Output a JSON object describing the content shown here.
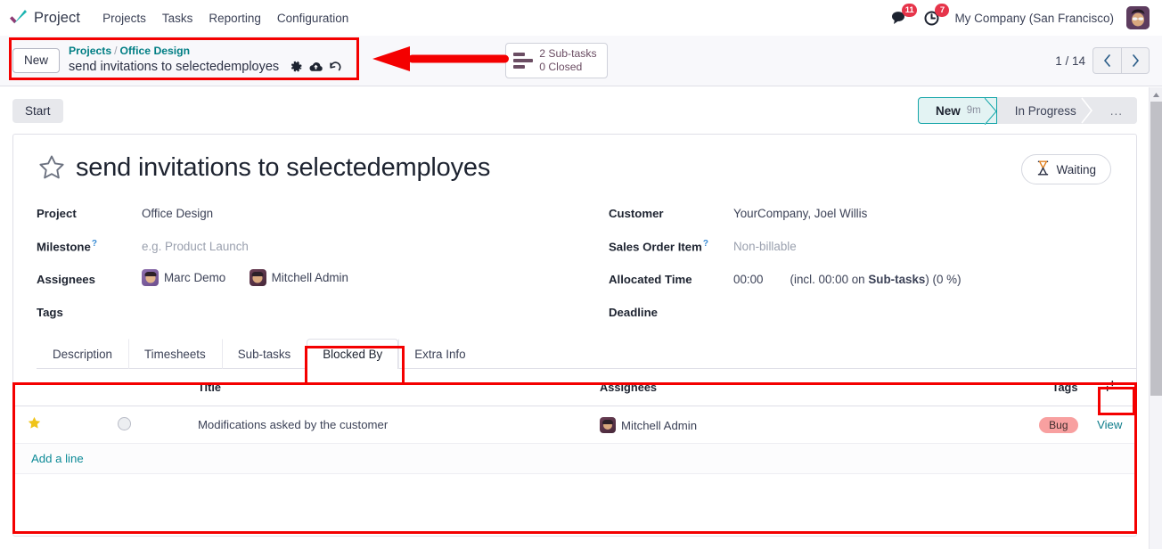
{
  "navbar": {
    "brand": "Project",
    "logo_icon": "odoo-check-logo",
    "menu": [
      "Projects",
      "Tasks",
      "Reporting",
      "Configuration"
    ],
    "messages_icon": "chat-bubble-icon",
    "messages_count": "11",
    "activities_icon": "clock-icon",
    "activities_count": "7",
    "company": "My Company (San Francisco)",
    "avatar_icon": "user-avatar"
  },
  "control_panel": {
    "new_label": "New",
    "breadcrumb": {
      "root": "Projects",
      "separator": "/",
      "parent": "Office Design",
      "current": "send invitations to selectedemployes"
    },
    "record_icons": [
      "gear-icon",
      "cloud-upload-icon",
      "undo-icon"
    ],
    "stat_button": {
      "icon": "subtasks-list-icon",
      "line1": "2 Sub-tasks",
      "line2": "0 Closed"
    },
    "pager": {
      "value": "1 / 14",
      "prev_icon": "chevron-left-icon",
      "next_icon": "chevron-right-icon"
    }
  },
  "statusbar": {
    "start_label": "Start",
    "stages": [
      {
        "label": "New",
        "duration": "9m",
        "active": true
      },
      {
        "label": "In Progress",
        "duration": "",
        "active": false
      },
      {
        "label": "...",
        "duration": "",
        "active": false
      }
    ]
  },
  "form": {
    "star_icon": "star-outline-icon",
    "title": "send invitations to selectedemployes",
    "waiting_badge": {
      "icon": "hourglass-icon",
      "label": "Waiting"
    },
    "left_fields": [
      {
        "label": "Project",
        "value": "Office Design",
        "muted": false,
        "help": false
      },
      {
        "label": "Milestone",
        "value": "e.g. Product Launch",
        "muted": true,
        "help": true
      },
      {
        "label": "Assignees",
        "value": "",
        "muted": false,
        "help": false
      },
      {
        "label": "Tags",
        "value": "",
        "muted": false,
        "help": false
      }
    ],
    "assignees": [
      {
        "name": "Marc Demo",
        "avatar": "marc"
      },
      {
        "name": "Mitchell Admin",
        "avatar": "mitchell"
      }
    ],
    "right_fields": [
      {
        "label": "Customer",
        "value": "YourCompany, Joel Willis",
        "muted": false,
        "help": false
      },
      {
        "label": "Sales Order Item",
        "value": "Non-billable",
        "muted": true,
        "help": true
      },
      {
        "label": "Allocated Time",
        "value": "00:00",
        "muted": false,
        "help": false
      },
      {
        "label": "Deadline",
        "value": "",
        "muted": false,
        "help": false
      }
    ],
    "allocated_time_extra_prefix": "(incl. 00:00 on ",
    "allocated_time_extra_bold": "Sub-tasks",
    "allocated_time_extra_suffix": ") (0 %)"
  },
  "notebook": {
    "tabs": [
      {
        "label": "Description",
        "active": false
      },
      {
        "label": "Timesheets",
        "active": false
      },
      {
        "label": "Sub-tasks",
        "active": false
      },
      {
        "label": "Blocked By",
        "active": true
      },
      {
        "label": "Extra Info",
        "active": false
      }
    ]
  },
  "table": {
    "headers": [
      "",
      "",
      "Title",
      "Assignees",
      "Tags",
      ""
    ],
    "optional_columns_icon": "sliders-icon",
    "rows": [
      {
        "star_icon": "star-filled-icon",
        "state_icon": "state-circle-icon",
        "title": "Modifications asked by the customer",
        "assignee": "Mitchell Admin",
        "assignee_avatar": "mitchell",
        "tag": "Bug",
        "tag_color": "#f8a0a0",
        "action": "View"
      }
    ],
    "add_line_label": "Add a line"
  },
  "annotations": {
    "color": "#f40000",
    "arrow_icon": "left-arrow-annotation"
  },
  "scrollbar": {
    "up_icon": "caret-up-icon"
  }
}
